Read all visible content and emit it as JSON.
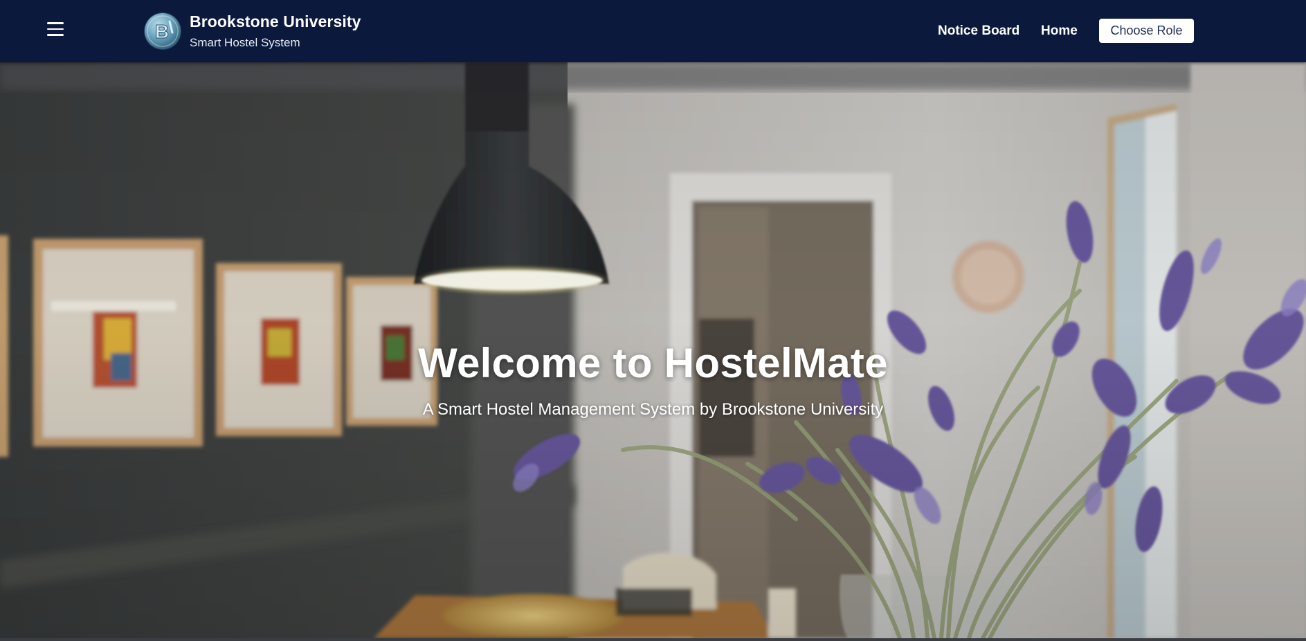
{
  "header": {
    "brand_title": "Brookstone University",
    "brand_subtitle": "Smart Hostel System",
    "nav": {
      "notice_board": "Notice Board",
      "home": "Home"
    },
    "choose_role_label": "Choose Role",
    "colors": {
      "navbar_bg": "#0b1a3c",
      "button_bg": "#ffffff",
      "button_text": "#1a2c5c"
    }
  },
  "hero": {
    "title": "Welcome to HostelMate",
    "subtitle": "A Smart Hostel Management System by Brookstone University"
  },
  "icons": {
    "menu": "hamburger-menu-icon",
    "logo": "university-logo"
  }
}
